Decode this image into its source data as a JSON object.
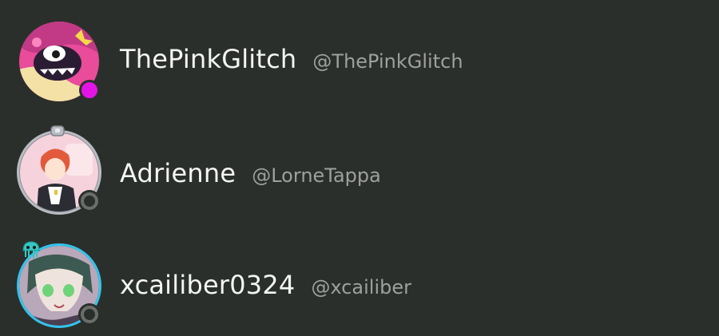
{
  "users": [
    {
      "display_name": "ThePinkGlitch",
      "handle": "@ThePinkGlitch",
      "status": "online",
      "status_color": "#e414e6"
    },
    {
      "display_name": "Adrienne",
      "handle": "@LorneTappa",
      "status": "offline",
      "status_color": "#6a6e6a"
    },
    {
      "display_name": "xcailiber0324",
      "handle": "@xcailiber",
      "status": "offline",
      "status_color": "#6a6e6a"
    }
  ],
  "colors": {
    "background": "#2b2f2b",
    "name_text": "#f4f5f4",
    "handle_text": "#9da09d",
    "frame_silver": "#b9bcc2",
    "frame_cyan": "#33c4ee"
  }
}
